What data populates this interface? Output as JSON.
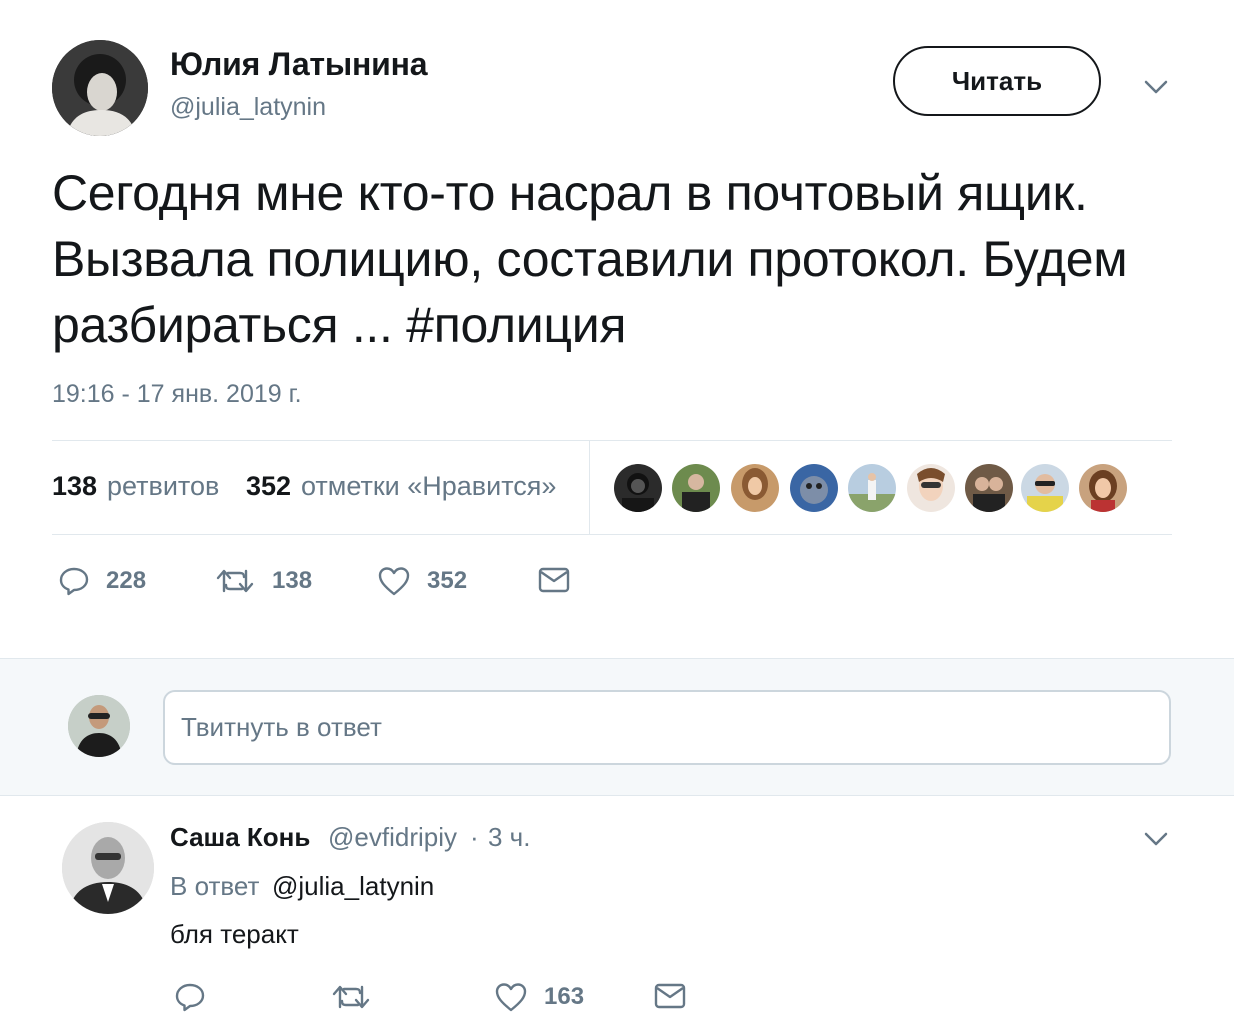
{
  "tweet": {
    "author_name": "Юлия Латынина",
    "author_handle": "@julia_latynin",
    "follow_label": "Читать",
    "text": "Сегодня мне кто-то насрал в почтовый ящик. Вызвала полицию, составили протокол. Будем разбираться ... #полиция",
    "hashtag": "#полиция",
    "timestamp": "19:16 - 17 янв. 2019 г.",
    "stats": {
      "retweets_count": "138",
      "retweets_label": "ретвитов",
      "likes_count": "352",
      "likes_label": "отметки «Нравится»"
    },
    "liker_avatars": [
      "liker-1",
      "liker-2",
      "liker-3",
      "liker-4",
      "liker-5",
      "liker-6",
      "liker-7",
      "liker-8",
      "liker-9"
    ],
    "actions": {
      "reply_count": "228",
      "retweet_count": "138",
      "like_count": "352"
    }
  },
  "reply_box": {
    "placeholder": "Твитнуть в ответ"
  },
  "reply": {
    "author_name": "Саша Конь",
    "author_handle": "@evfidripiy",
    "separator": "·",
    "time": "3 ч.",
    "replying_to_label": "В ответ",
    "replying_to_handle": "@julia_latynin",
    "text": "бля теракт",
    "actions": {
      "reply_count": "",
      "retweet_count": "",
      "like_count": "163"
    }
  },
  "colors": {
    "text": "#14171a",
    "muted": "#657786",
    "border": "#e1e8ed",
    "background_alt": "#f5f8fa"
  },
  "icons": [
    "reply-icon",
    "retweet-icon",
    "like-icon",
    "message-icon",
    "chevron-down-icon"
  ]
}
